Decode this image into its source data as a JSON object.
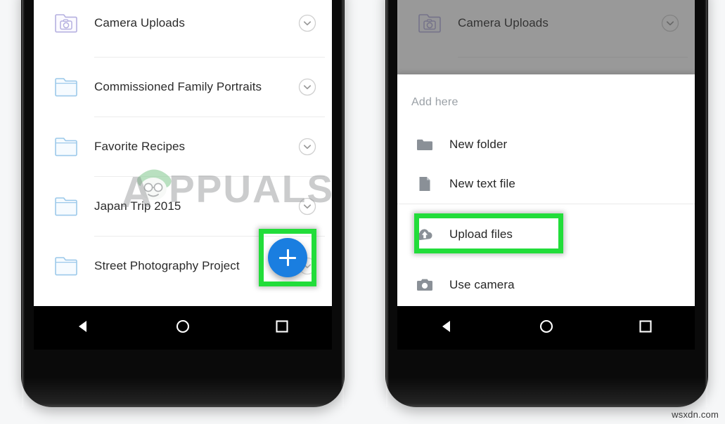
{
  "page": {
    "background_color": "#f6f7f8",
    "watermark_brand": "PPUALS",
    "watermark_site": "wsxdn.com"
  },
  "colors": {
    "fab_blue": "#1a7ee0",
    "highlight_green": "#22dd3a",
    "folder_blue": "#9cc9ea",
    "folder_purple": "#b5b0e0",
    "menu_icon_gray": "#8a9097",
    "list_text": "#2b2b2b",
    "sheet_title_gray": "#9aa0a6"
  },
  "left_phone": {
    "name": "file-browser-screen",
    "file_rows": [
      {
        "label": "Camera Uploads",
        "icon": "camera-folder-icon",
        "chevron": "chevron-down-circle-icon"
      },
      {
        "label": "Commissioned Family Portraits",
        "icon": "folder-icon",
        "chevron": "chevron-down-circle-icon"
      },
      {
        "label": "Favorite Recipes",
        "icon": "folder-icon",
        "chevron": "chevron-down-circle-icon"
      },
      {
        "label": "Japan Trip 2015",
        "icon": "folder-icon",
        "chevron": "chevron-down-circle-icon"
      },
      {
        "label": "Street Photography Project",
        "icon": "folder-icon",
        "chevron": "chevron-down-circle-icon"
      }
    ],
    "fab": {
      "name": "add-fab",
      "icon": "plus-icon",
      "label": "+"
    },
    "highlight": {
      "target": "add-fab",
      "color": "#22dd3a"
    },
    "navbar": {
      "back": "back-triangle-icon",
      "home": "home-circle-icon",
      "recents": "recents-square-icon"
    }
  },
  "right_phone": {
    "name": "add-here-sheet-screen",
    "background_row": {
      "label": "Camera Uploads",
      "icon": "camera-folder-icon",
      "chevron": "chevron-down-circle-icon"
    },
    "sheet": {
      "title": "Add here",
      "items": [
        {
          "label": "New folder",
          "icon": "folder-solid-icon"
        },
        {
          "label": "New text file",
          "icon": "text-file-icon"
        },
        {
          "label": "Upload files",
          "icon": "cloud-upload-icon",
          "highlighted": true
        },
        {
          "label": "Use camera",
          "icon": "camera-icon"
        }
      ]
    },
    "highlight": {
      "target": "menu-item-upload-files",
      "color": "#22dd3a"
    },
    "navbar": {
      "back": "back-triangle-icon",
      "home": "home-circle-icon",
      "recents": "recents-square-icon"
    }
  }
}
